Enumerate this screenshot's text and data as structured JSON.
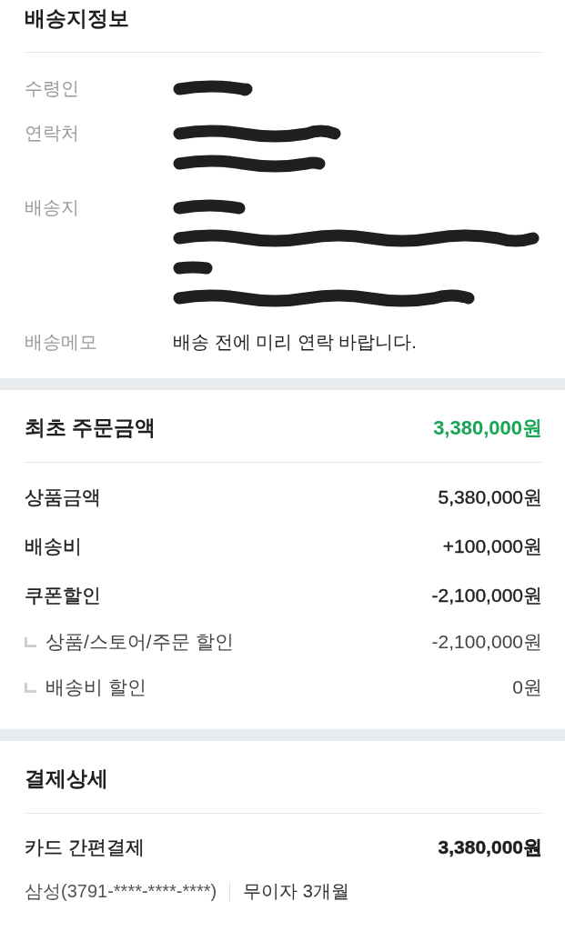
{
  "shipping": {
    "title": "배송지정보",
    "rows": [
      {
        "label": "수령인",
        "lines": [
          {
            "kind": "redacted"
          }
        ]
      },
      {
        "label": "연락처",
        "lines": [
          {
            "kind": "redacted"
          },
          {
            "kind": "redacted"
          }
        ]
      },
      {
        "label": "배송지",
        "lines": [
          {
            "kind": "redacted"
          },
          {
            "kind": "redacted"
          },
          {
            "kind": "redacted"
          },
          {
            "kind": "redacted"
          }
        ]
      },
      {
        "label": "배송메모",
        "lines": [
          {
            "kind": "text",
            "text": "배송 전에 미리 연락 바랍니다."
          }
        ]
      }
    ]
  },
  "order": {
    "title": "최초 주문금액",
    "total": "3,380,000원",
    "items": [
      {
        "kind": "main",
        "label": "상품금액",
        "amount": "5,380,000원"
      },
      {
        "kind": "main",
        "label": "배송비",
        "amount": "+100,000원"
      },
      {
        "kind": "main",
        "label": "쿠폰할인",
        "amount": "-2,100,000원"
      },
      {
        "kind": "sub",
        "label": "상품/스토어/주문 할인",
        "amount": "-2,100,000원"
      },
      {
        "kind": "sub",
        "label": "배송비 할인",
        "amount": "0원"
      }
    ]
  },
  "payment": {
    "title": "결제상세",
    "method": "카드 간편결제",
    "amount": "3,380,000원",
    "card": "삼성(3791-****-****-****)",
    "installment": "무이자 3개월"
  }
}
